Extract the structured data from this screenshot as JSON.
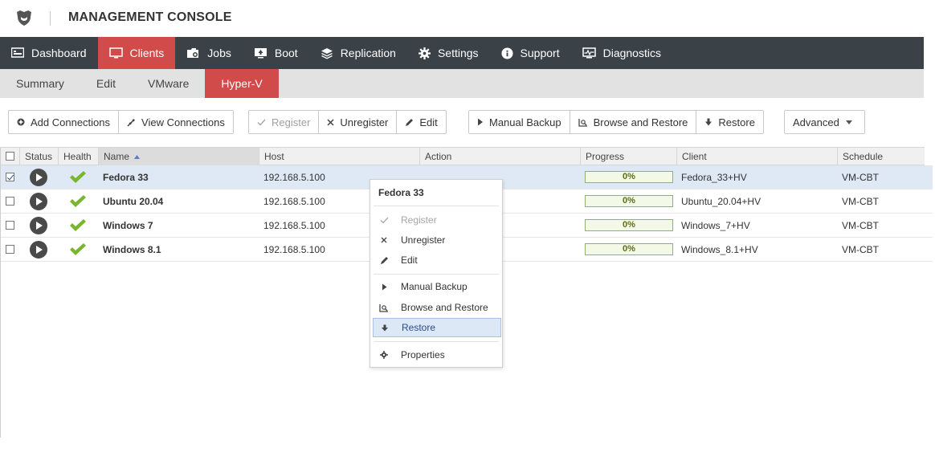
{
  "header": {
    "title": "MANAGEMENT CONSOLE"
  },
  "mainnav": [
    {
      "label": "Dashboard",
      "icon": "dashboard-icon"
    },
    {
      "label": "Clients",
      "icon": "monitor-icon",
      "active": true
    },
    {
      "label": "Jobs",
      "icon": "jobs-icon"
    },
    {
      "label": "Boot",
      "icon": "boot-icon"
    },
    {
      "label": "Replication",
      "icon": "layers-icon"
    },
    {
      "label": "Settings",
      "icon": "gear-icon"
    },
    {
      "label": "Support",
      "icon": "info-icon"
    },
    {
      "label": "Diagnostics",
      "icon": "diagnostics-icon"
    }
  ],
  "subnav": [
    {
      "label": "Summary"
    },
    {
      "label": "Edit"
    },
    {
      "label": "VMware"
    },
    {
      "label": "Hyper-V",
      "active": true
    }
  ],
  "toolbar": {
    "add_connections": "Add Connections",
    "view_connections": "View Connections",
    "register": "Register",
    "unregister": "Unregister",
    "edit": "Edit",
    "manual_backup": "Manual Backup",
    "browse_restore": "Browse and Restore",
    "restore": "Restore",
    "advanced": "Advanced"
  },
  "table": {
    "columns": {
      "status": "Status",
      "health": "Health",
      "name": "Name",
      "host": "Host",
      "action": "Action",
      "progress": "Progress",
      "client": "Client",
      "schedule": "Schedule"
    },
    "rows": [
      {
        "name": "Fedora 33",
        "host": "192.168.5.100",
        "action": "",
        "progress": "0%",
        "client": "Fedora_33+HV",
        "schedule": "VM-CBT",
        "checked": true
      },
      {
        "name": "Ubuntu 20.04",
        "host": "192.168.5.100",
        "action": "",
        "progress": "0%",
        "client": "Ubuntu_20.04+HV",
        "schedule": "VM-CBT",
        "checked": false
      },
      {
        "name": "Windows 7",
        "host": "192.168.5.100",
        "action": "",
        "progress": "0%",
        "client": "Windows_7+HV",
        "schedule": "VM-CBT",
        "checked": false
      },
      {
        "name": "Windows 8.1",
        "host": "192.168.5.100",
        "action": "",
        "progress": "0%",
        "client": "Windows_8.1+HV",
        "schedule": "VM-CBT",
        "checked": false
      }
    ]
  },
  "context_menu": {
    "title": "Fedora 33",
    "register": "Register",
    "unregister": "Unregister",
    "edit": "Edit",
    "manual_backup": "Manual Backup",
    "browse_restore": "Browse and Restore",
    "restore": "Restore",
    "properties": "Properties"
  },
  "colors": {
    "accent": "#d04b4a",
    "nav_bg": "#3a4248",
    "subnav_bg": "#e2e2e2",
    "health_green": "#7ab530",
    "selected_row": "#dfe8f5"
  }
}
